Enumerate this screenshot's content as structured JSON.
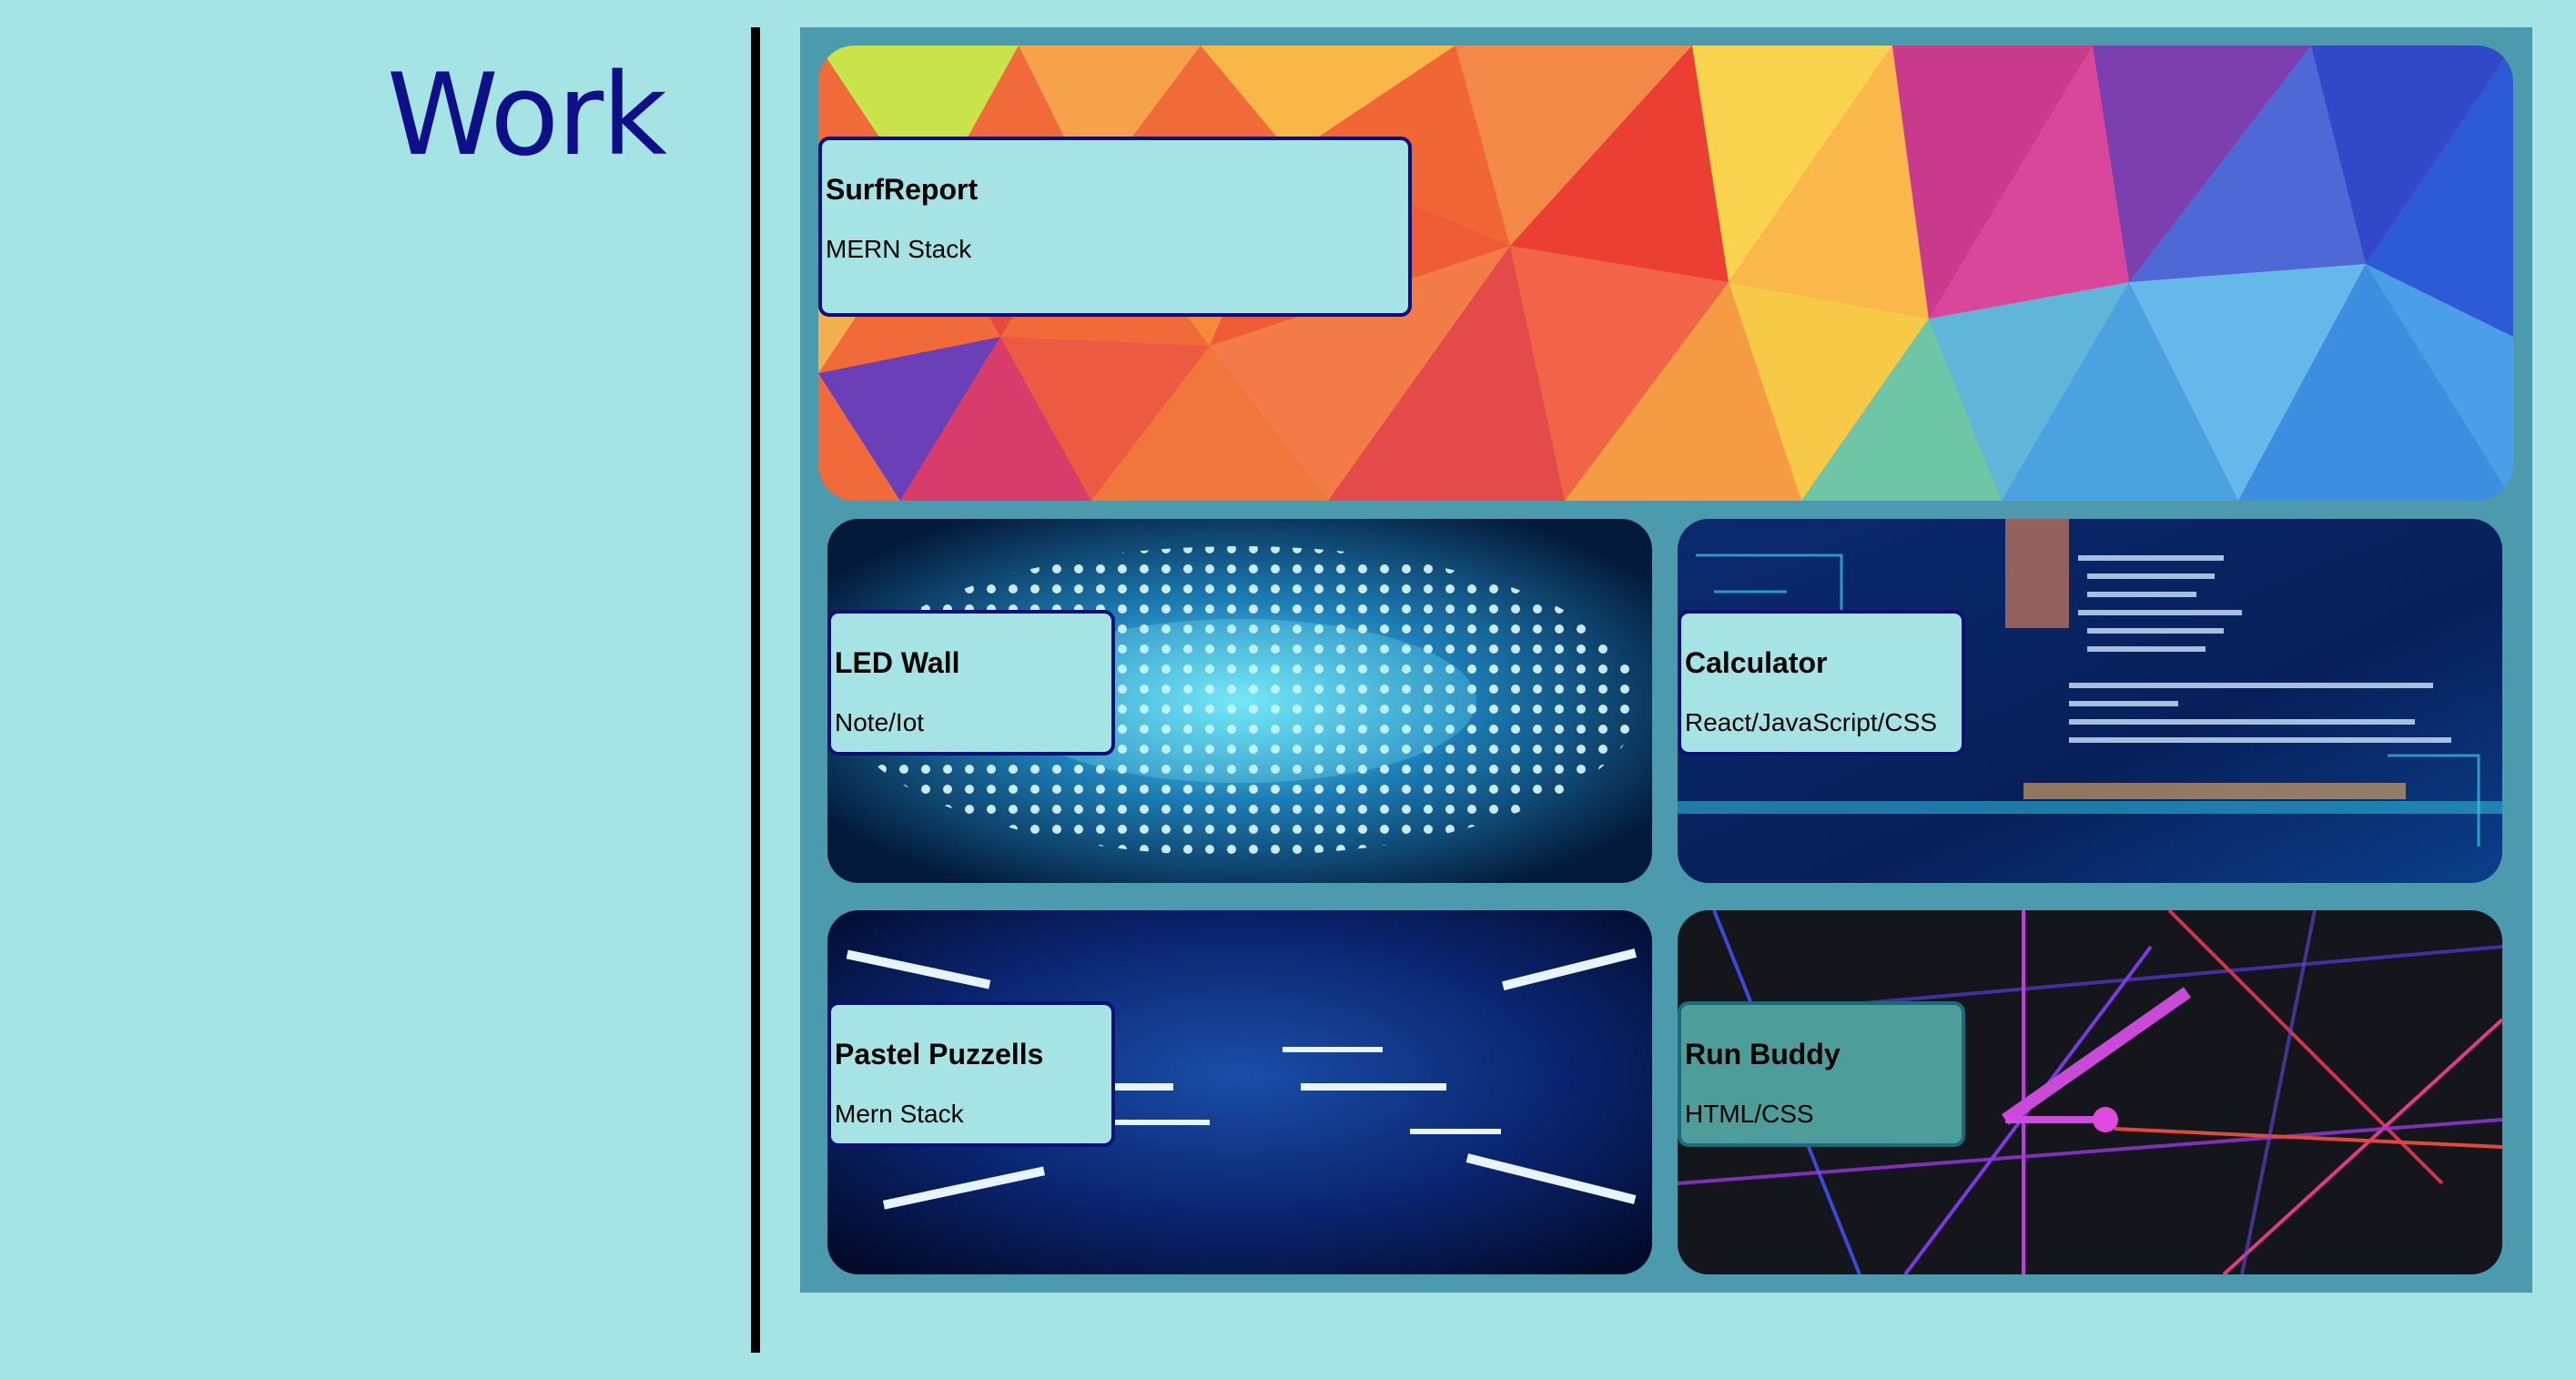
{
  "page": {
    "title": "Work"
  },
  "projects": [
    {
      "title": "SurfReport",
      "stack": "MERN Stack",
      "image": "polygon-rainbow-image"
    },
    {
      "title": "LED Wall",
      "stack": "Note/Iot",
      "image": "led-lights-image"
    },
    {
      "title": "Calculator",
      "stack": "React/JavaScript/CSS",
      "image": "code-screen-image"
    },
    {
      "title": "Pastel Puzzells",
      "stack": "Mern Stack",
      "image": "light-tunnel-image"
    },
    {
      "title": "Run Buddy",
      "stack": "HTML/CSS",
      "image": "neon-lines-image"
    }
  ],
  "colors": {
    "background": "#a6e3e5",
    "title": "#0f0f89",
    "grid": "#4b9aae",
    "label_border": "#0f0f7a"
  }
}
